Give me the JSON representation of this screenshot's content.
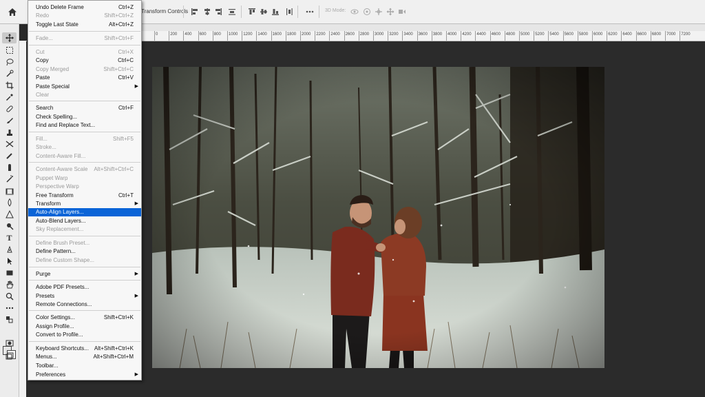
{
  "options_bar": {
    "transform_label": "Transform Controls",
    "label_3d": "3D Mode:",
    "home_icon": "home-icon"
  },
  "ruler_ticks": [
    "0",
    "200",
    "400",
    "600",
    "800",
    "1000",
    "1200",
    "1400",
    "1600",
    "1800",
    "2000",
    "2200",
    "2400",
    "2600",
    "2800",
    "3000",
    "3200",
    "3400",
    "3600",
    "3800",
    "4000",
    "4200",
    "4400",
    "4600",
    "4800",
    "5000",
    "5200",
    "5400",
    "5600",
    "5800",
    "6000",
    "6200",
    "6400",
    "6600",
    "6800",
    "7000",
    "7200"
  ],
  "edit_menu": {
    "items": [
      {
        "label": "Undo Delete Frame",
        "shortcut": "Ctrl+Z",
        "disabled": false
      },
      {
        "label": "Redo",
        "shortcut": "Shift+Ctrl+Z",
        "disabled": true
      },
      {
        "label": "Toggle Last State",
        "shortcut": "Alt+Ctrl+Z",
        "disabled": false
      },
      {
        "label": "Fade...",
        "shortcut": "Shift+Ctrl+F",
        "disabled": true
      },
      {
        "label": "Cut",
        "shortcut": "Ctrl+X",
        "disabled": true
      },
      {
        "label": "Copy",
        "shortcut": "Ctrl+C",
        "disabled": false
      },
      {
        "label": "Copy Merged",
        "shortcut": "Shift+Ctrl+C",
        "disabled": true
      },
      {
        "label": "Paste",
        "shortcut": "Ctrl+V",
        "disabled": false
      },
      {
        "label": "Paste Special",
        "shortcut": "",
        "disabled": false
      },
      {
        "label": "Clear",
        "shortcut": "",
        "disabled": true
      },
      {
        "label": "Search",
        "shortcut": "Ctrl+F",
        "disabled": false
      },
      {
        "label": "Check Spelling...",
        "shortcut": "",
        "disabled": false
      },
      {
        "label": "Find and Replace Text...",
        "shortcut": "",
        "disabled": false
      },
      {
        "label": "Fill...",
        "shortcut": "Shift+F5",
        "disabled": true
      },
      {
        "label": "Stroke...",
        "shortcut": "",
        "disabled": true
      },
      {
        "label": "Content-Aware Fill...",
        "shortcut": "",
        "disabled": true
      },
      {
        "label": "Content-Aware Scale",
        "shortcut": "Alt+Shift+Ctrl+C",
        "disabled": true
      },
      {
        "label": "Puppet Warp",
        "shortcut": "",
        "disabled": true
      },
      {
        "label": "Perspective Warp",
        "shortcut": "",
        "disabled": true
      },
      {
        "label": "Free Transform",
        "shortcut": "Ctrl+T",
        "disabled": false
      },
      {
        "label": "Transform",
        "shortcut": "",
        "disabled": false
      },
      {
        "label": "Auto-Align Layers...",
        "shortcut": "",
        "disabled": false
      },
      {
        "label": "Auto-Blend Layers...",
        "shortcut": "",
        "disabled": false
      },
      {
        "label": "Sky Replacement...",
        "shortcut": "",
        "disabled": true
      },
      {
        "label": "Define Brush Preset...",
        "shortcut": "",
        "disabled": true
      },
      {
        "label": "Define Pattern...",
        "shortcut": "",
        "disabled": false
      },
      {
        "label": "Define Custom Shape...",
        "shortcut": "",
        "disabled": true
      },
      {
        "label": "Purge",
        "shortcut": "",
        "disabled": false
      },
      {
        "label": "Adobe PDF Presets...",
        "shortcut": "",
        "disabled": false
      },
      {
        "label": "Presets",
        "shortcut": "",
        "disabled": false
      },
      {
        "label": "Remote Connections...",
        "shortcut": "",
        "disabled": false
      },
      {
        "label": "Color Settings...",
        "shortcut": "Shift+Ctrl+K",
        "disabled": false
      },
      {
        "label": "Assign Profile...",
        "shortcut": "",
        "disabled": false
      },
      {
        "label": "Convert to Profile...",
        "shortcut": "",
        "disabled": false
      },
      {
        "label": "Keyboard Shortcuts...",
        "shortcut": "Alt+Shift+Ctrl+K",
        "disabled": false
      },
      {
        "label": "Menus...",
        "shortcut": "Alt+Shift+Ctrl+M",
        "disabled": false
      },
      {
        "label": "Toolbar...",
        "shortcut": "",
        "disabled": false
      },
      {
        "label": "Preferences",
        "shortcut": "",
        "disabled": false
      }
    ]
  },
  "colors": {
    "highlight": "#0a64d7",
    "canvas_bg": "#2b2b2b"
  }
}
